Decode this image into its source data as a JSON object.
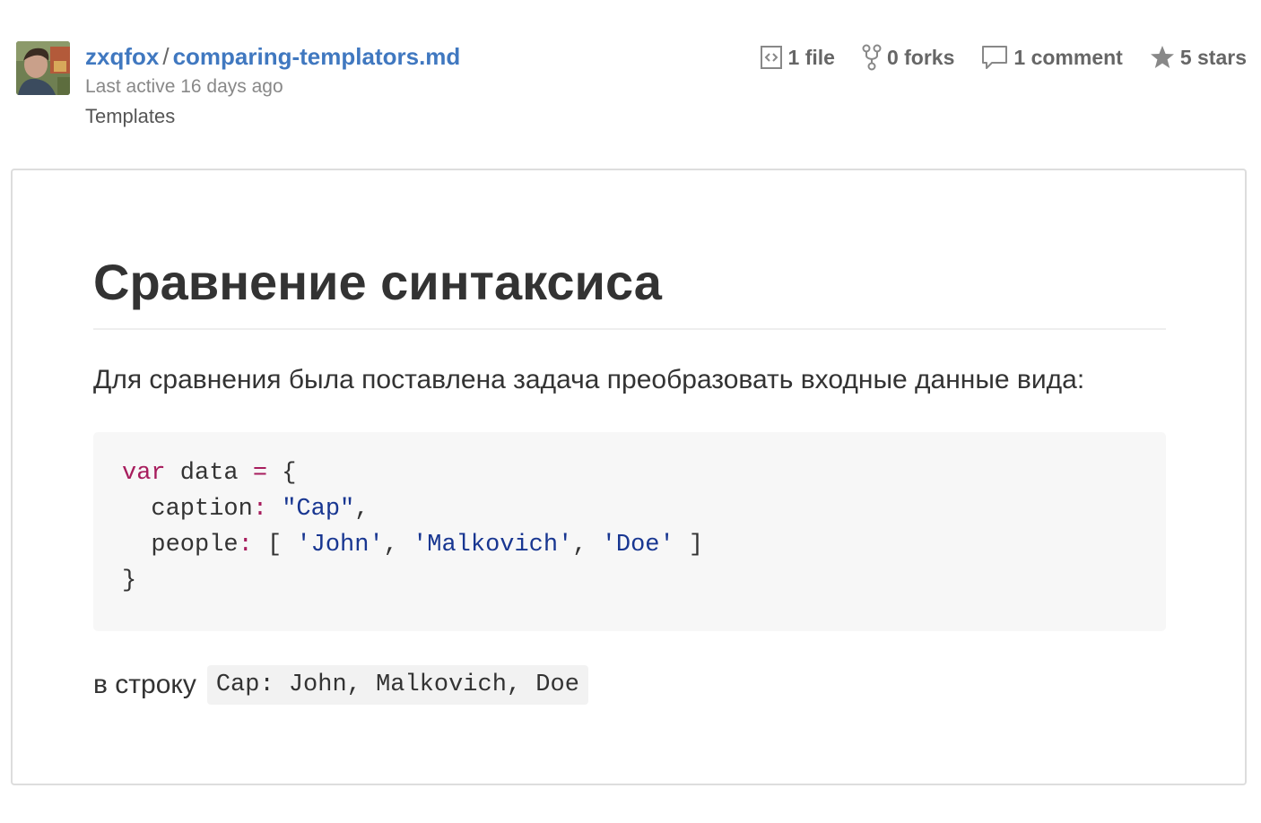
{
  "header": {
    "owner": "zxqfox",
    "separator": "/",
    "gist_name": "comparing-templators.md",
    "last_active": "Last active 16 days ago",
    "description": "Templates"
  },
  "stats": {
    "files": "1 file",
    "forks": "0 forks",
    "comments": "1 comment",
    "stars": "5 stars"
  },
  "icons": {
    "files": "code-file-icon",
    "forks": "fork-icon",
    "comments": "comment-icon",
    "stars": "star-icon"
  },
  "content": {
    "heading": "Сравнение синтаксиса",
    "intro": "Для сравнения была поставлена задача преобразовать входные данные вида:",
    "code": {
      "l1_kw": "var",
      "l1_rest": " data ",
      "l1_op": "=",
      "l1_end": " {",
      "l2_key": "  caption",
      "l2_colon": ":",
      "l2_sp": " ",
      "l2_str": "\"Cap\"",
      "l2_end": ",",
      "l3_key": "  people",
      "l3_colon": ":",
      "l3_open": " [ ",
      "l3_s1": "'John'",
      "l3_c1": ", ",
      "l3_s2": "'Malkovich'",
      "l3_c2": ", ",
      "l3_s3": "'Doe'",
      "l3_close": " ]",
      "l4": "}"
    },
    "result_label": "в строку",
    "result_code": "Cap: John, Malkovich, Doe"
  },
  "colors": {
    "link": "#4078c0",
    "keyword": "#a71d5d",
    "string": "#183691",
    "code_bg": "#f7f7f7",
    "border": "#dddddd"
  }
}
